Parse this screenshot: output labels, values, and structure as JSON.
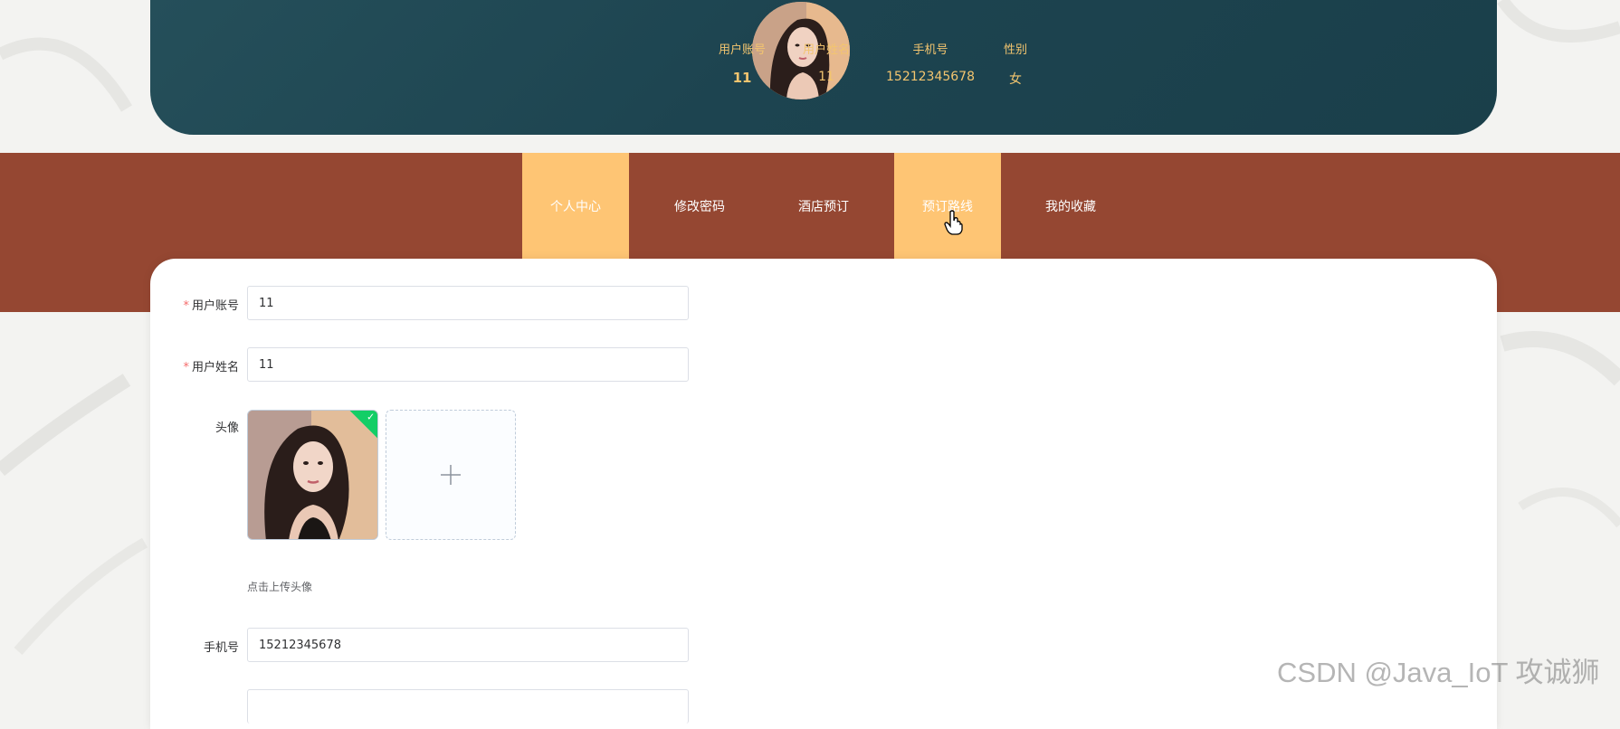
{
  "header": {
    "stats": [
      {
        "label": "用户账号",
        "value": "11"
      },
      {
        "label": "用户姓名",
        "value": "11"
      },
      {
        "label": "手机号",
        "value": "15212345678"
      },
      {
        "label": "性别",
        "value": "女"
      }
    ]
  },
  "nav": {
    "items": [
      {
        "label": "个人中心",
        "active": true
      },
      {
        "label": "修改密码",
        "active": false
      },
      {
        "label": "酒店预订",
        "active": false
      },
      {
        "label": "预订路线",
        "active": true
      },
      {
        "label": "我的收藏",
        "active": false
      }
    ]
  },
  "form": {
    "account": {
      "label": "用户账号",
      "required_mark": "*",
      "value": "11"
    },
    "name": {
      "label": "用户姓名",
      "required_mark": "*",
      "value": "11"
    },
    "avatar": {
      "label": "头像",
      "upload_hint": "点击上传头像",
      "uploaded": true
    },
    "phone": {
      "label": "手机号",
      "value": "15212345678"
    }
  },
  "watermark": "CSDN @Java_IoT 攻诚狮",
  "colors": {
    "header_bg": "#1d4450",
    "accent_gold": "#f3c56f",
    "nav_bg": "#954732",
    "nav_active": "#fec574",
    "success_green": "#13ce66",
    "required_red": "#f56c6c"
  },
  "icons": {
    "upload": "plus-icon",
    "uploaded_badge": "check-icon",
    "pointer": "hand-cursor-icon"
  }
}
